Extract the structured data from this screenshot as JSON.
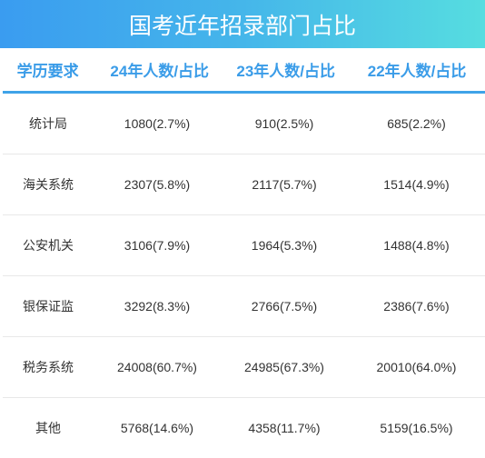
{
  "title": "国考近年招录部门占比",
  "colors": {
    "banner_gradient_start": "#3a9cf0",
    "banner_gradient_end": "#56dde0",
    "header_text": "#3a9ce8",
    "header_rule": "#3fa3e8",
    "body_text": "#333333",
    "row_divider": "#e8e8e8"
  },
  "table": {
    "headers": [
      "学历要求",
      "24年人数/占比",
      "23年人数/占比",
      "22年人数/占比"
    ],
    "rows": [
      [
        "统计局",
        "1080(2.7%)",
        "910(2.5%)",
        "685(2.2%)"
      ],
      [
        "海关系统",
        "2307(5.8%)",
        "2117(5.7%)",
        "1514(4.9%)"
      ],
      [
        "公安机关",
        "3106(7.9%)",
        "1964(5.3%)",
        "1488(4.8%)"
      ],
      [
        "银保证监",
        "3292(8.3%)",
        "2766(7.5%)",
        "2386(7.6%)"
      ],
      [
        "税务系统",
        "24008(60.7%)",
        "24985(67.3%)",
        "20010(64.0%)"
      ],
      [
        "其他",
        "5768(14.6%)",
        "4358(11.7%)",
        "5159(16.5%)"
      ]
    ]
  }
}
